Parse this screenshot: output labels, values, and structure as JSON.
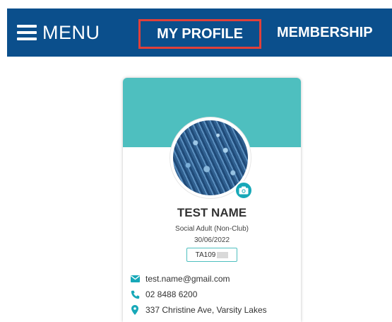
{
  "nav": {
    "menu_label": "MENU",
    "links": [
      "MY PROFILE",
      "MEMBERSHIP"
    ],
    "active": "MY PROFILE",
    "bar_color": "#0b4f8c",
    "highlight_color": "#e0403a"
  },
  "profile": {
    "name": "TEST NAME",
    "membership_type": "Social Adult (Non-Club)",
    "date": "30/06/2022",
    "member_id": "TA109",
    "email": "test.name@gmail.com",
    "phone": "02 8488 6200",
    "address": "337 Christine Ave, Varsity Lakes",
    "accent_color": "#4ebfbf",
    "icons": {
      "avatar_action": "camera-icon",
      "email": "envelope-icon",
      "phone": "phone-icon",
      "address": "map-pin-icon"
    }
  }
}
